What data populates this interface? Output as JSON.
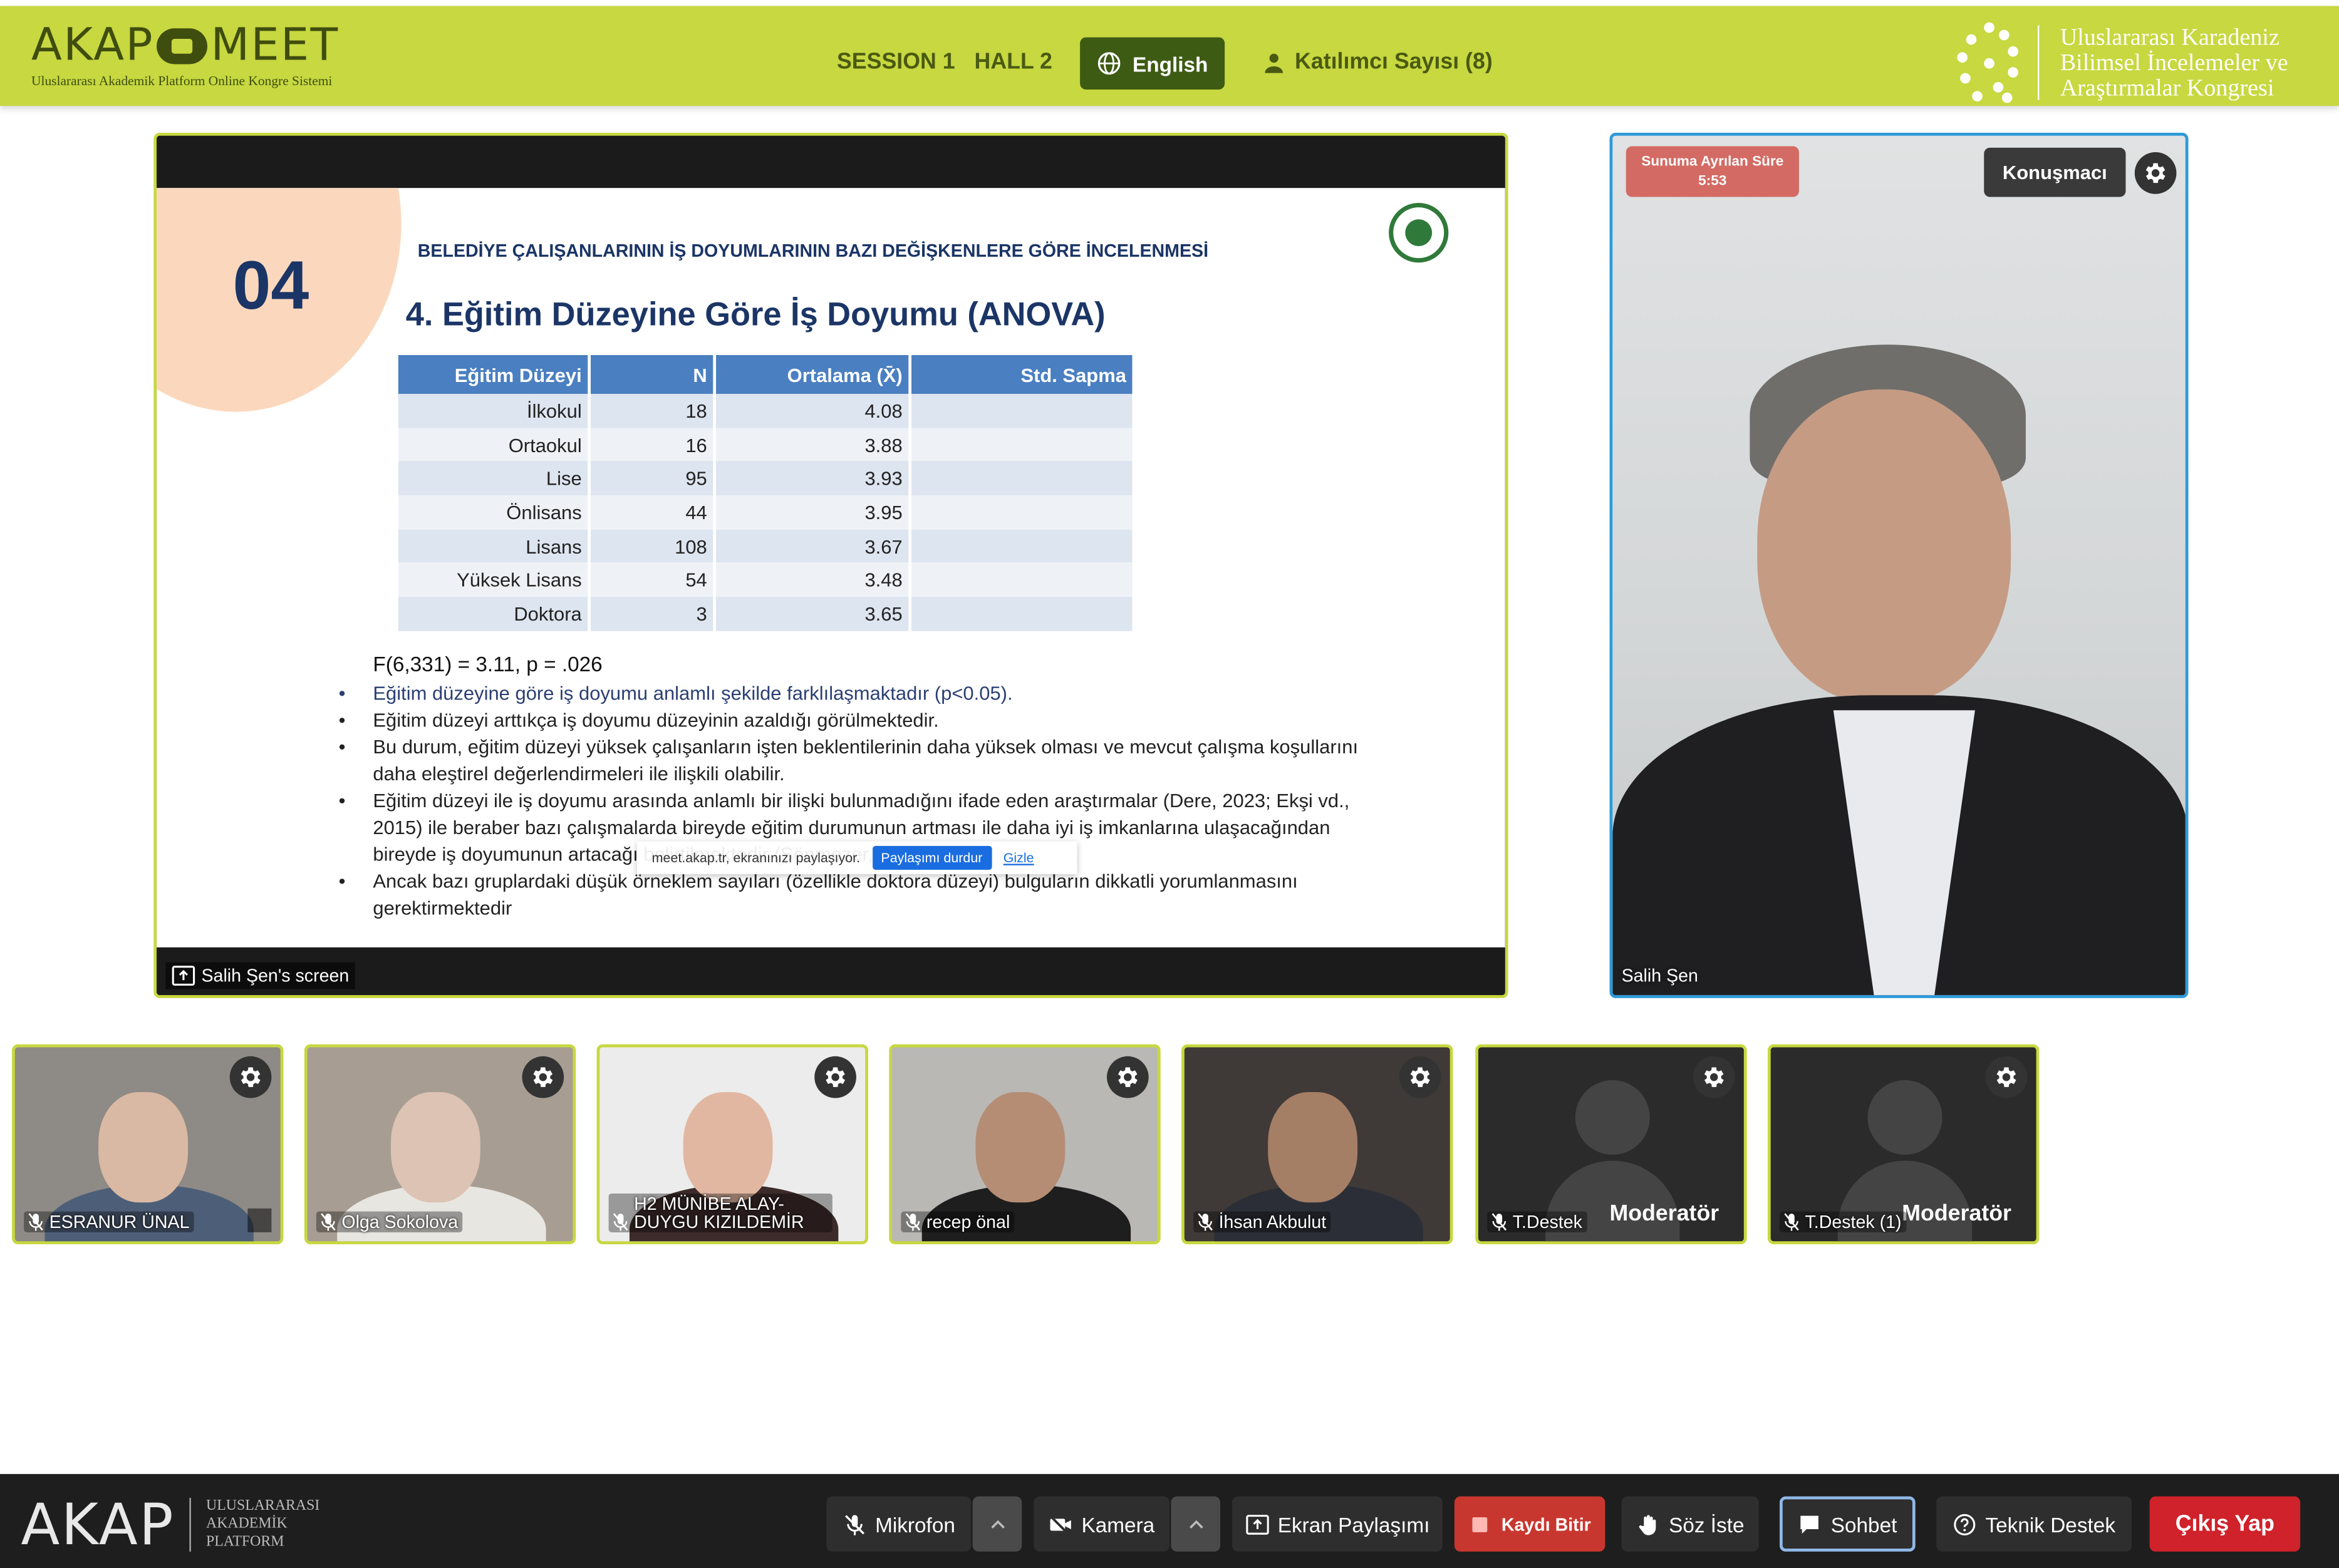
{
  "header": {
    "logo_text_left": "AKAP",
    "logo_text_right": "MEET",
    "logo_subtitle": "Uluslararası Akademik Platform Online Kongre Sistemi",
    "session": "SESSION 1",
    "hall": "HALL 2",
    "language_button": "English",
    "participants": "Katılımcı Sayısı (8)",
    "org_line1": "Uluslararası Karadeniz",
    "org_line2": "Bilimsel İncelemeler ve",
    "org_line3": "Araştırmalar Kongresi",
    "accent_color": "#c7d840"
  },
  "slide": {
    "number": "04",
    "subtitle": "BELEDİYE ÇALIŞANLARININ İŞ DOYUMLARININ BAZI DEĞİŞKENLERE GÖRE İNCELENMESİ",
    "title": "4. Eğitim Düzeyine Göre İş Doyumu (ANOVA)",
    "table": {
      "headers": [
        "Eğitim Düzeyi",
        "N",
        "Ortalama (X̄)",
        "Std. Sapma"
      ],
      "rows": [
        [
          "İlkokul",
          "18",
          "4.08",
          ""
        ],
        [
          "Ortaokul",
          "16",
          "3.88",
          ""
        ],
        [
          "Lise",
          "95",
          "3.93",
          ""
        ],
        [
          "Önlisans",
          "44",
          "3.95",
          ""
        ],
        [
          "Lisans",
          "108",
          "3.67",
          ""
        ],
        [
          "Yüksek Lisans",
          "54",
          "3.48",
          ""
        ],
        [
          "Doktora",
          "3",
          "3.65",
          ""
        ]
      ]
    },
    "fstat": "F(6,331) = 3.11, p = .026",
    "bullets": [
      "Eğitim düzeyine göre iş doyumu anlamlı şekilde farklılaşmaktadır (p<0.05).",
      "Eğitim düzeyi arttıkça iş doyumu düzeyinin azaldığı görülmektedir.",
      "Bu durum, eğitim düzeyi yüksek çalışanların işten beklentilerinin daha yüksek olması ve mevcut çalışma koşullarını daha eleştirel değerlendirmeleri ile ilişkili olabilir.",
      "Eğitim düzeyi ile iş doyumu arasında anlamlı bir ilişki bulunmadığını ifade eden araştırmalar (Dere, 2023; Ekşi vd., 2015) ile beraber bazı çalışmalarda bireyde eğitim durumunun artması ile daha iyi iş imkanlarına ulaşacağından bireyde iş doyumunun artacağı belirtilmektedir (Sönmezer, 2007).",
      "Ancak bazı gruplardaki düşük örneklem sayıları (özellikle doktora düzeyi) bulguların dikkatli yorumlanmasını gerektirmektedir"
    ]
  },
  "share_banner": {
    "text": "meet.akap.tr, ekranınızı paylaşıyor.",
    "stop_button": "Paylaşımı durdur",
    "hide_link": "Gizle"
  },
  "screen_label": "Salih Şen's screen",
  "speaker": {
    "timer_label": "Sunuma Ayrılan Süre",
    "timer_value": "5:53",
    "role_button": "Konuşmacı",
    "name": "Salih Şen"
  },
  "participants": [
    {
      "name": "ESRANUR ÜNAL",
      "type": "video",
      "bg": "#8e8a86",
      "face": "#d9b9a3",
      "torso": "#4d5f78"
    },
    {
      "name": "Olga Sokolova",
      "type": "video",
      "bg": "#a79d93",
      "face": "#dcc3b3",
      "torso": "#e8e6e1"
    },
    {
      "name": "H2 MÜNİBE ALAY-DUYGU KIZILDEMİR",
      "type": "video",
      "bg": "#ececec",
      "face": "#e1b7a2",
      "torso": "#3c2b2a"
    },
    {
      "name": "recep önal",
      "type": "video",
      "bg": "#b9b8b5",
      "face": "#b58d75",
      "torso": "#1e1e1e"
    },
    {
      "name": "İhsan Akbulut",
      "type": "video",
      "bg": "#3f3a37",
      "face": "#a57e66",
      "torso": "#2b2e36"
    },
    {
      "name": "T.Destek",
      "type": "avatar",
      "badge": "Moderatör"
    },
    {
      "name": "T.Destek (1)",
      "type": "avatar",
      "badge": "Moderatör"
    }
  ],
  "controls": {
    "microphone": "Mikrofon",
    "camera": "Kamera",
    "screen_share": "Ekran Paylaşımı",
    "stop_record": "Kaydı Bitir",
    "raise_hand": "Söz İste",
    "chat": "Sohbet",
    "support": "Teknik Destek",
    "exit": "Çıkış Yap"
  },
  "footer_logo": {
    "word": "AKAP",
    "line1": "ULUSLARARASI",
    "line2": "AKADEMİK",
    "line3": "PLATFORM"
  }
}
